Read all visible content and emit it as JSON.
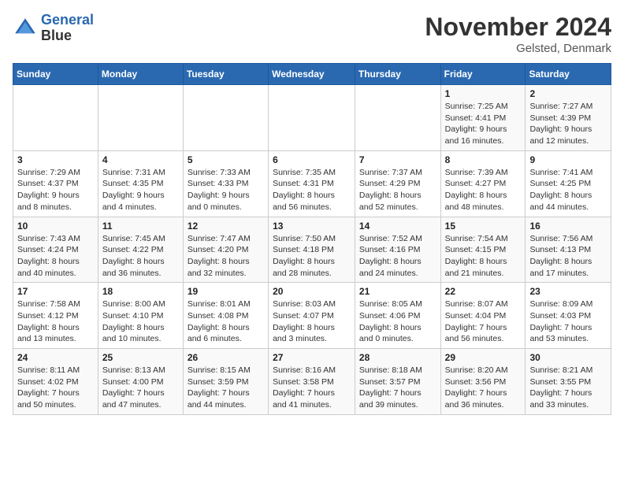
{
  "logo": {
    "line1": "General",
    "line2": "Blue"
  },
  "title": "November 2024",
  "location": "Gelsted, Denmark",
  "weekdays": [
    "Sunday",
    "Monday",
    "Tuesday",
    "Wednesday",
    "Thursday",
    "Friday",
    "Saturday"
  ],
  "weeks": [
    [
      {
        "day": "",
        "info": ""
      },
      {
        "day": "",
        "info": ""
      },
      {
        "day": "",
        "info": ""
      },
      {
        "day": "",
        "info": ""
      },
      {
        "day": "",
        "info": ""
      },
      {
        "day": "1",
        "info": "Sunrise: 7:25 AM\nSunset: 4:41 PM\nDaylight: 9 hours and 16 minutes."
      },
      {
        "day": "2",
        "info": "Sunrise: 7:27 AM\nSunset: 4:39 PM\nDaylight: 9 hours and 12 minutes."
      }
    ],
    [
      {
        "day": "3",
        "info": "Sunrise: 7:29 AM\nSunset: 4:37 PM\nDaylight: 9 hours and 8 minutes."
      },
      {
        "day": "4",
        "info": "Sunrise: 7:31 AM\nSunset: 4:35 PM\nDaylight: 9 hours and 4 minutes."
      },
      {
        "day": "5",
        "info": "Sunrise: 7:33 AM\nSunset: 4:33 PM\nDaylight: 9 hours and 0 minutes."
      },
      {
        "day": "6",
        "info": "Sunrise: 7:35 AM\nSunset: 4:31 PM\nDaylight: 8 hours and 56 minutes."
      },
      {
        "day": "7",
        "info": "Sunrise: 7:37 AM\nSunset: 4:29 PM\nDaylight: 8 hours and 52 minutes."
      },
      {
        "day": "8",
        "info": "Sunrise: 7:39 AM\nSunset: 4:27 PM\nDaylight: 8 hours and 48 minutes."
      },
      {
        "day": "9",
        "info": "Sunrise: 7:41 AM\nSunset: 4:25 PM\nDaylight: 8 hours and 44 minutes."
      }
    ],
    [
      {
        "day": "10",
        "info": "Sunrise: 7:43 AM\nSunset: 4:24 PM\nDaylight: 8 hours and 40 minutes."
      },
      {
        "day": "11",
        "info": "Sunrise: 7:45 AM\nSunset: 4:22 PM\nDaylight: 8 hours and 36 minutes."
      },
      {
        "day": "12",
        "info": "Sunrise: 7:47 AM\nSunset: 4:20 PM\nDaylight: 8 hours and 32 minutes."
      },
      {
        "day": "13",
        "info": "Sunrise: 7:50 AM\nSunset: 4:18 PM\nDaylight: 8 hours and 28 minutes."
      },
      {
        "day": "14",
        "info": "Sunrise: 7:52 AM\nSunset: 4:16 PM\nDaylight: 8 hours and 24 minutes."
      },
      {
        "day": "15",
        "info": "Sunrise: 7:54 AM\nSunset: 4:15 PM\nDaylight: 8 hours and 21 minutes."
      },
      {
        "day": "16",
        "info": "Sunrise: 7:56 AM\nSunset: 4:13 PM\nDaylight: 8 hours and 17 minutes."
      }
    ],
    [
      {
        "day": "17",
        "info": "Sunrise: 7:58 AM\nSunset: 4:12 PM\nDaylight: 8 hours and 13 minutes."
      },
      {
        "day": "18",
        "info": "Sunrise: 8:00 AM\nSunset: 4:10 PM\nDaylight: 8 hours and 10 minutes."
      },
      {
        "day": "19",
        "info": "Sunrise: 8:01 AM\nSunset: 4:08 PM\nDaylight: 8 hours and 6 minutes."
      },
      {
        "day": "20",
        "info": "Sunrise: 8:03 AM\nSunset: 4:07 PM\nDaylight: 8 hours and 3 minutes."
      },
      {
        "day": "21",
        "info": "Sunrise: 8:05 AM\nSunset: 4:06 PM\nDaylight: 8 hours and 0 minutes."
      },
      {
        "day": "22",
        "info": "Sunrise: 8:07 AM\nSunset: 4:04 PM\nDaylight: 7 hours and 56 minutes."
      },
      {
        "day": "23",
        "info": "Sunrise: 8:09 AM\nSunset: 4:03 PM\nDaylight: 7 hours and 53 minutes."
      }
    ],
    [
      {
        "day": "24",
        "info": "Sunrise: 8:11 AM\nSunset: 4:02 PM\nDaylight: 7 hours and 50 minutes."
      },
      {
        "day": "25",
        "info": "Sunrise: 8:13 AM\nSunset: 4:00 PM\nDaylight: 7 hours and 47 minutes."
      },
      {
        "day": "26",
        "info": "Sunrise: 8:15 AM\nSunset: 3:59 PM\nDaylight: 7 hours and 44 minutes."
      },
      {
        "day": "27",
        "info": "Sunrise: 8:16 AM\nSunset: 3:58 PM\nDaylight: 7 hours and 41 minutes."
      },
      {
        "day": "28",
        "info": "Sunrise: 8:18 AM\nSunset: 3:57 PM\nDaylight: 7 hours and 39 minutes."
      },
      {
        "day": "29",
        "info": "Sunrise: 8:20 AM\nSunset: 3:56 PM\nDaylight: 7 hours and 36 minutes."
      },
      {
        "day": "30",
        "info": "Sunrise: 8:21 AM\nSunset: 3:55 PM\nDaylight: 7 hours and 33 minutes."
      }
    ]
  ]
}
